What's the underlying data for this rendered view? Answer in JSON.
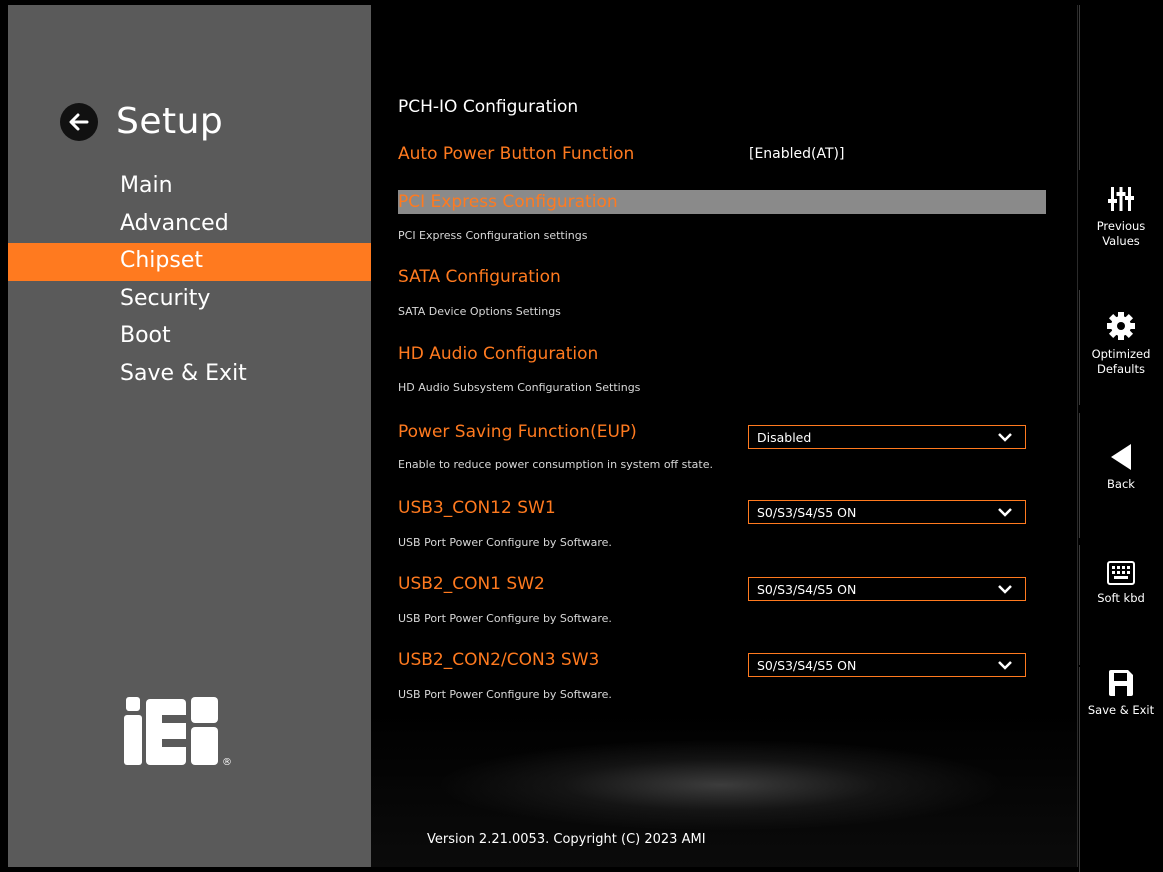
{
  "sidebar": {
    "title": "Setup",
    "menu": [
      "Main",
      "Advanced",
      "Chipset",
      "Security",
      "Boot",
      "Save & Exit"
    ],
    "active": "Chipset",
    "logo_text": "iEi",
    "logo_mark": "®"
  },
  "main": {
    "page_title": "PCH-IO Configuration",
    "auto_power": {
      "label": "Auto Power Button Function",
      "value": "[Enabled(AT)]"
    },
    "pci": {
      "label": "PCI Express Configuration",
      "help": "PCI Express Configuration settings"
    },
    "sata": {
      "label": "SATA Configuration",
      "help": "SATA Device Options Settings"
    },
    "hda": {
      "label": "HD Audio Configuration",
      "help": "HD Audio Subsystem Configuration Settings"
    },
    "eup": {
      "label": "Power Saving Function(EUP)",
      "value": "Disabled",
      "help": "Enable to reduce power consumption in system off state."
    },
    "usb3": {
      "label": "USB3_CON12 SW1",
      "value": "S0/S3/S4/S5 ON",
      "help": "USB Port Power Configure by Software."
    },
    "usb2a": {
      "label": "USB2_CON1 SW2",
      "value": "S0/S3/S4/S5 ON",
      "help": "USB Port Power Configure by Software."
    },
    "usb2b": {
      "label": "USB2_CON2/CON3 SW3",
      "value": "S0/S3/S4/S5 ON",
      "help": "USB Port Power Configure by Software."
    },
    "version": "Version 2.21.0053. Copyright (C) 2023 AMI"
  },
  "actions": {
    "previous": "Previous Values",
    "optimized": "Optimized Defaults",
    "back": "Back",
    "softkbd": "Soft kbd",
    "save_exit": "Save & Exit"
  },
  "colors": {
    "accent": "#ff7a1f",
    "sidebar": "#5a5a5a",
    "highlight": "#8a8a8a"
  }
}
